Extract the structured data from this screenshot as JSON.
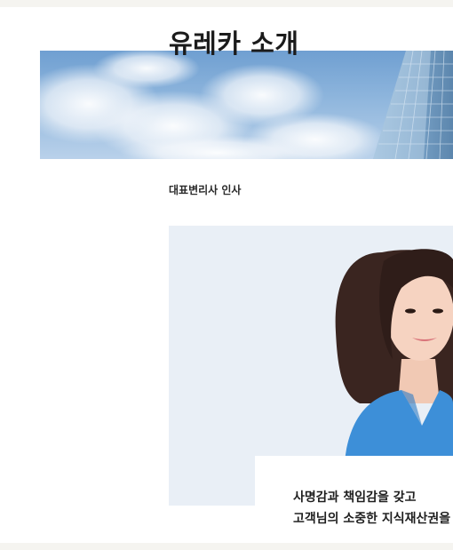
{
  "page": {
    "title": "유레카 소개",
    "breadcrumb": "대표변리사 인사"
  },
  "hero": {
    "image": "sky-and-glass-building"
  },
  "portrait": {
    "image": "woman-in-blue-blouse-portrait"
  },
  "quote": {
    "lines": [
      "사명감과 책임감을 갖고",
      "고객님의 소중한 지식재산권을"
    ]
  },
  "colors": {
    "page_bg": "#f5f4f0",
    "card_bg": "#ffffff",
    "text": "#1b1b1b",
    "sky": "#7faad6",
    "blouse": "#3d8fd8"
  }
}
